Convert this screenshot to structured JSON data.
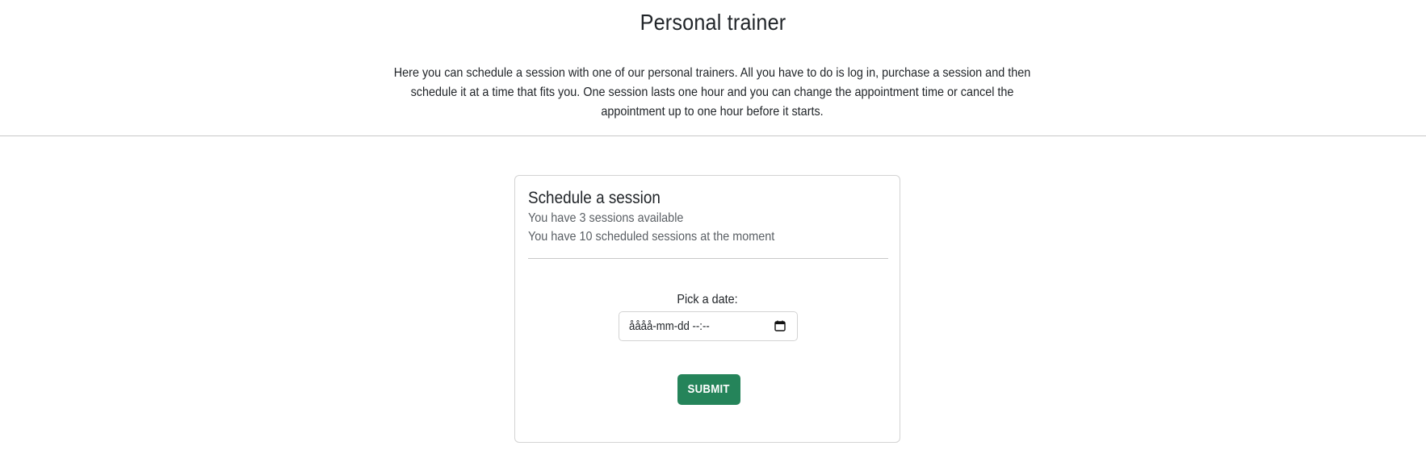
{
  "header": {
    "title": "Personal trainer",
    "intro": "Here you can schedule a session with one of our personal trainers. All you have to do is log in, purchase a session and then schedule it at a time that fits you. One session lasts one hour and you can change the appointment time or cancel the appointment up to one hour before it starts."
  },
  "card": {
    "title": "Schedule a session",
    "available_text": "You have 3 sessions available",
    "scheduled_text": "You have 10 scheduled sessions at the moment",
    "date_label": "Pick a date:",
    "date_value": "åååå-mm-dd --:--",
    "submit_label": "SUBMIT"
  },
  "colors": {
    "submit_bg": "#25845a",
    "border": "#d3d3d3",
    "divider": "#c8c8c8"
  },
  "icons": {
    "date_picker": "calendar-icon"
  }
}
